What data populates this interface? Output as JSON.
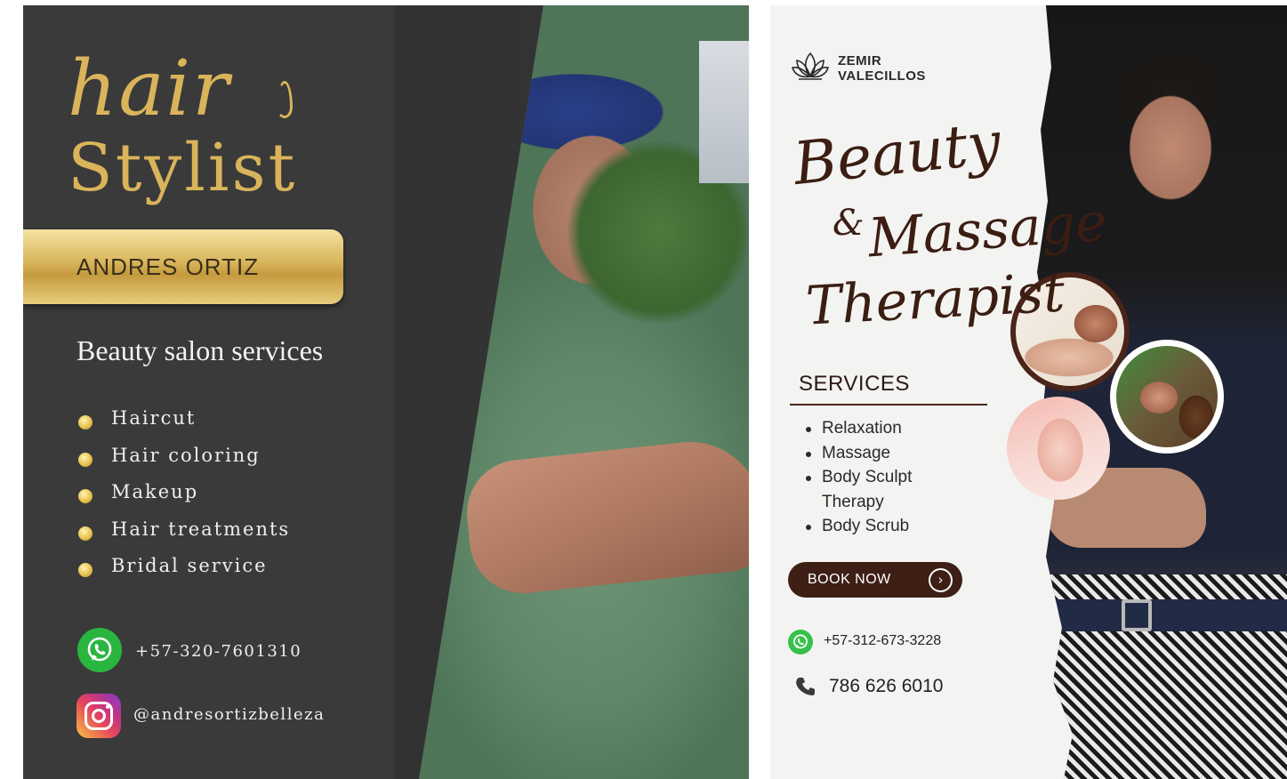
{
  "left_flyer": {
    "title_line1": "hair",
    "title_line2": "Stylist",
    "name": "ANDRES ORTIZ",
    "subtitle": "Beauty salon services",
    "services": [
      "Haircut",
      "Hair coloring",
      "Makeup",
      "Hair treatments",
      "Bridal service"
    ],
    "phone": "+57-320-7601310",
    "instagram": "@andresortizbelleza",
    "colors": {
      "background": "#3a3a3a",
      "gold": "#d9b45a",
      "whatsapp": "#2ab540"
    },
    "icons": [
      "flame-icon",
      "bullet-icon",
      "whatsapp-icon",
      "instagram-icon"
    ]
  },
  "right_flyer": {
    "brand_line1": "ZEMIR",
    "brand_line2": "VALECILLOS",
    "script_line1": "Beauty",
    "script_amp": "&",
    "script_line2": "Massage",
    "script_line3": "Therapist",
    "services_heading": "SERVICES",
    "services": [
      "Relaxation",
      "Massage",
      "Body Sculpt Therapy",
      "Body Scrub"
    ],
    "book_button": "BOOK NOW",
    "book_button_arrow": "›",
    "whatsapp_phone": "+57-312-673-3228",
    "phone": "786 626 6010",
    "colors": {
      "background": "#f3f3f1",
      "brown": "#3d1f16",
      "whatsapp": "#36c14a"
    },
    "icons": [
      "lotus-icon",
      "whatsapp-icon",
      "phone-icon",
      "chevron-right-icon"
    ]
  }
}
